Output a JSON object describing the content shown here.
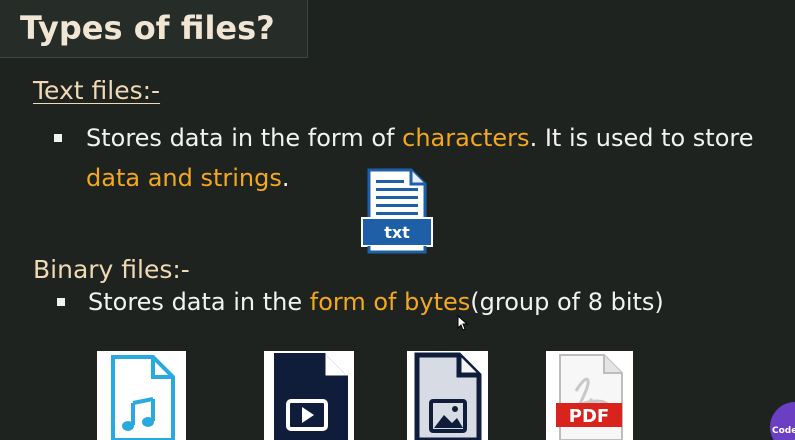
{
  "title": "Types of files?",
  "text_files": {
    "heading": "Text files:-",
    "bullet": {
      "part1": "Stores data in the form of ",
      "highlight1": "characters",
      "part2": ". It is used to store",
      "highlight2": "data and strings",
      "part3": "."
    },
    "icon_label": "txt"
  },
  "binary_files": {
    "heading": "Binary files:-",
    "bullet": {
      "part1": "Stores data in the ",
      "highlight": "form of bytes",
      "part2": "(group of 8 bits)"
    },
    "pdf_label": "PDF"
  },
  "logo_text": "Code-",
  "colors": {
    "background": "#1e231f",
    "heading": "#f0d9b5",
    "highlight": "#f4a81f",
    "text": "#f2f2f2",
    "txt_icon_blue": "#1f5fa8",
    "audio_icon_cyan": "#29a9e0",
    "pdf_red": "#d9231d",
    "navy": "#0f1d3a"
  },
  "icons": [
    "txt-file-icon",
    "audio-file-icon",
    "video-file-icon",
    "image-file-icon",
    "pdf-file-icon"
  ]
}
